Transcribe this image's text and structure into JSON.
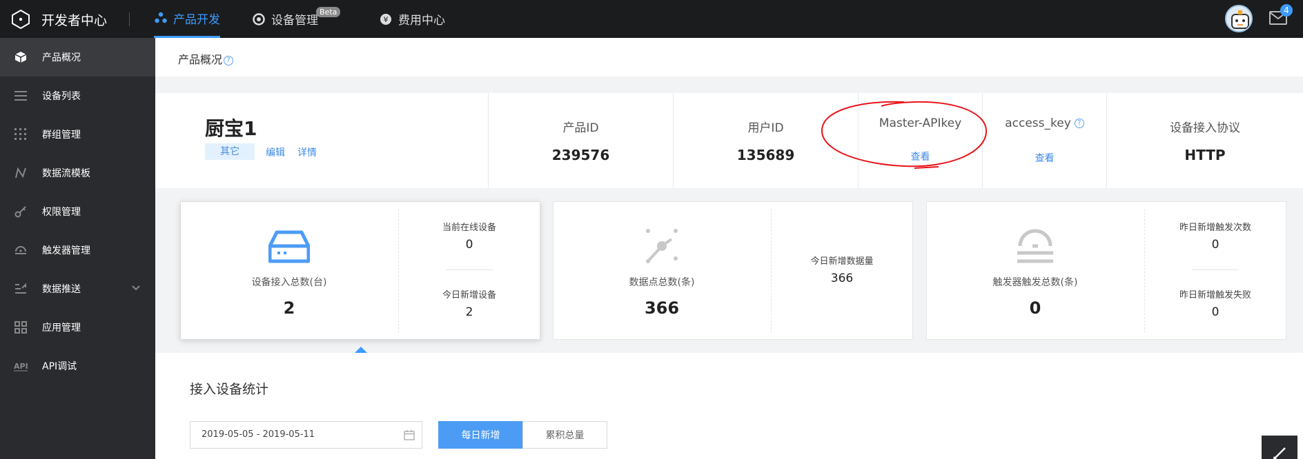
{
  "topbar": {
    "brand": "开发者中心",
    "nav": [
      {
        "label": "产品开发",
        "icon": "product-dev-icon",
        "active": true
      },
      {
        "label": "设备管理",
        "icon": "device-manage-icon",
        "badge": "Beta"
      },
      {
        "label": "费用中心",
        "icon": "yen-icon"
      }
    ],
    "mail_count": "4"
  },
  "sidebar": {
    "items": [
      {
        "label": "产品概况",
        "icon": "cube-icon",
        "active": true
      },
      {
        "label": "设备列表",
        "icon": "list-icon"
      },
      {
        "label": "群组管理",
        "icon": "grid-dots-icon"
      },
      {
        "label": "数据流模板",
        "icon": "flow-icon"
      },
      {
        "label": "权限管理",
        "icon": "key-icon"
      },
      {
        "label": "触发器管理",
        "icon": "trigger-icon"
      },
      {
        "label": "数据推送",
        "icon": "push-icon",
        "expandable": true
      },
      {
        "label": "应用管理",
        "icon": "apps-icon"
      },
      {
        "label": "API调试",
        "icon": "api-icon"
      }
    ]
  },
  "page": {
    "title": "产品概况",
    "help": "?"
  },
  "product": {
    "name": "厨宝1",
    "tag": "其它",
    "edit_label": "编辑",
    "detail_label": "详情"
  },
  "info": {
    "product_id_label": "产品ID",
    "product_id": "239576",
    "user_id_label": "用户ID",
    "user_id": "135689",
    "master_key_label": "Master-APIkey",
    "master_key_link": "查看",
    "access_key_label": "access_key",
    "access_key_link": "查看",
    "protocol_label": "设备接入协议",
    "protocol": "HTTP"
  },
  "cards": {
    "devices": {
      "main_label": "设备接入总数(台)",
      "main_value": "2",
      "online_label": "当前在线设备",
      "online_value": "0",
      "new_label": "今日新增设备",
      "new_value": "2"
    },
    "datapoints": {
      "main_label": "数据点总数(条)",
      "main_value": "366",
      "new_label": "今日新增数据量",
      "new_value": "366"
    },
    "triggers": {
      "main_label": "触发器触发总数(条)",
      "main_value": "0",
      "yesterday_label": "昨日新增触发次数",
      "yesterday_value": "0",
      "fail_label": "昨日新增触发失败",
      "fail_value": "0"
    }
  },
  "stats": {
    "title": "接入设备统计",
    "date_range": "2019-05-05 - 2019-05-11",
    "daily_label": "每日新增",
    "total_label": "累积总量"
  },
  "colors": {
    "accent": "#3d9bff",
    "topbar_bg": "#1b1c1e",
    "sidebar_bg": "#2a2b2e",
    "annotation": "#e8141a"
  }
}
